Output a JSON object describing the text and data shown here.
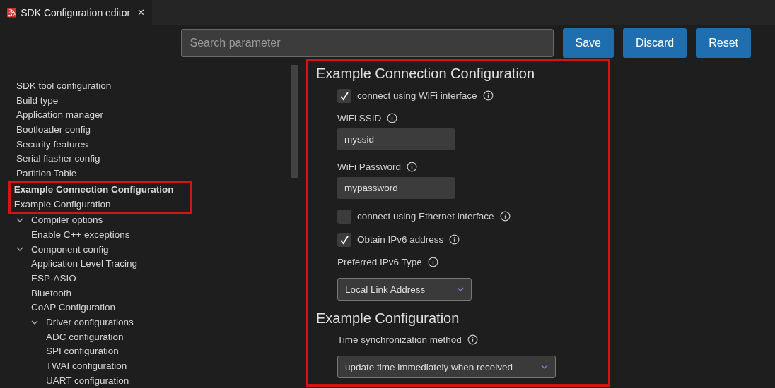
{
  "tab": {
    "title": "SDK Configuration editor",
    "close": "✕"
  },
  "toolbar": {
    "search": {
      "placeholder": "Search parameter"
    },
    "buttons": [
      "Save",
      "Discard",
      "Reset"
    ]
  },
  "sidebar": {
    "items": [
      {
        "label": "SDK tool configuration"
      },
      {
        "label": "Build type"
      },
      {
        "label": "Application manager"
      },
      {
        "label": "Bootloader config"
      },
      {
        "label": "Security features"
      },
      {
        "label": "Serial flasher config"
      },
      {
        "label": "Partition Table"
      },
      {
        "label": "Example Connection Configuration",
        "highlighted": true,
        "selected": true
      },
      {
        "label": "Example Configuration",
        "highlighted": true,
        "selected": false
      },
      {
        "label": "Compiler options",
        "expanded": true,
        "children": [
          {
            "label": "Enable C++ exceptions"
          }
        ]
      },
      {
        "label": "Component config",
        "expanded": true,
        "children": [
          {
            "label": "Application Level Tracing"
          },
          {
            "label": "ESP-ASIO"
          },
          {
            "label": "Bluetooth"
          },
          {
            "label": "CoAP Configuration"
          },
          {
            "label": "Driver configurations",
            "expanded": true,
            "children": [
              {
                "label": "ADC configuration"
              },
              {
                "label": "SPI configuration"
              },
              {
                "label": "TWAI configuration"
              },
              {
                "label": "UART configuration"
              }
            ]
          }
        ]
      }
    ]
  },
  "content": {
    "highlighted": true,
    "sections": [
      {
        "title": "Example Connection Configuration",
        "params": [
          {
            "kind": "checkbox",
            "label": "connect using WiFi interface",
            "checked": true
          },
          {
            "kind": "text",
            "label": "WiFi SSID",
            "value": "myssid"
          },
          {
            "kind": "text",
            "label": "WiFi Password",
            "value": "mypassword"
          },
          {
            "kind": "checkbox",
            "label": "connect using Ethernet interface",
            "checked": false
          },
          {
            "kind": "checkbox",
            "label": "Obtain IPv6 address",
            "checked": true
          },
          {
            "kind": "select",
            "label": "Preferred IPv6 Type",
            "value": "Local Link Address"
          }
        ]
      },
      {
        "title": "Example Configuration",
        "params": [
          {
            "kind": "select",
            "label": "Time synchronization method",
            "value": "update time immediately when received"
          }
        ]
      }
    ]
  }
}
